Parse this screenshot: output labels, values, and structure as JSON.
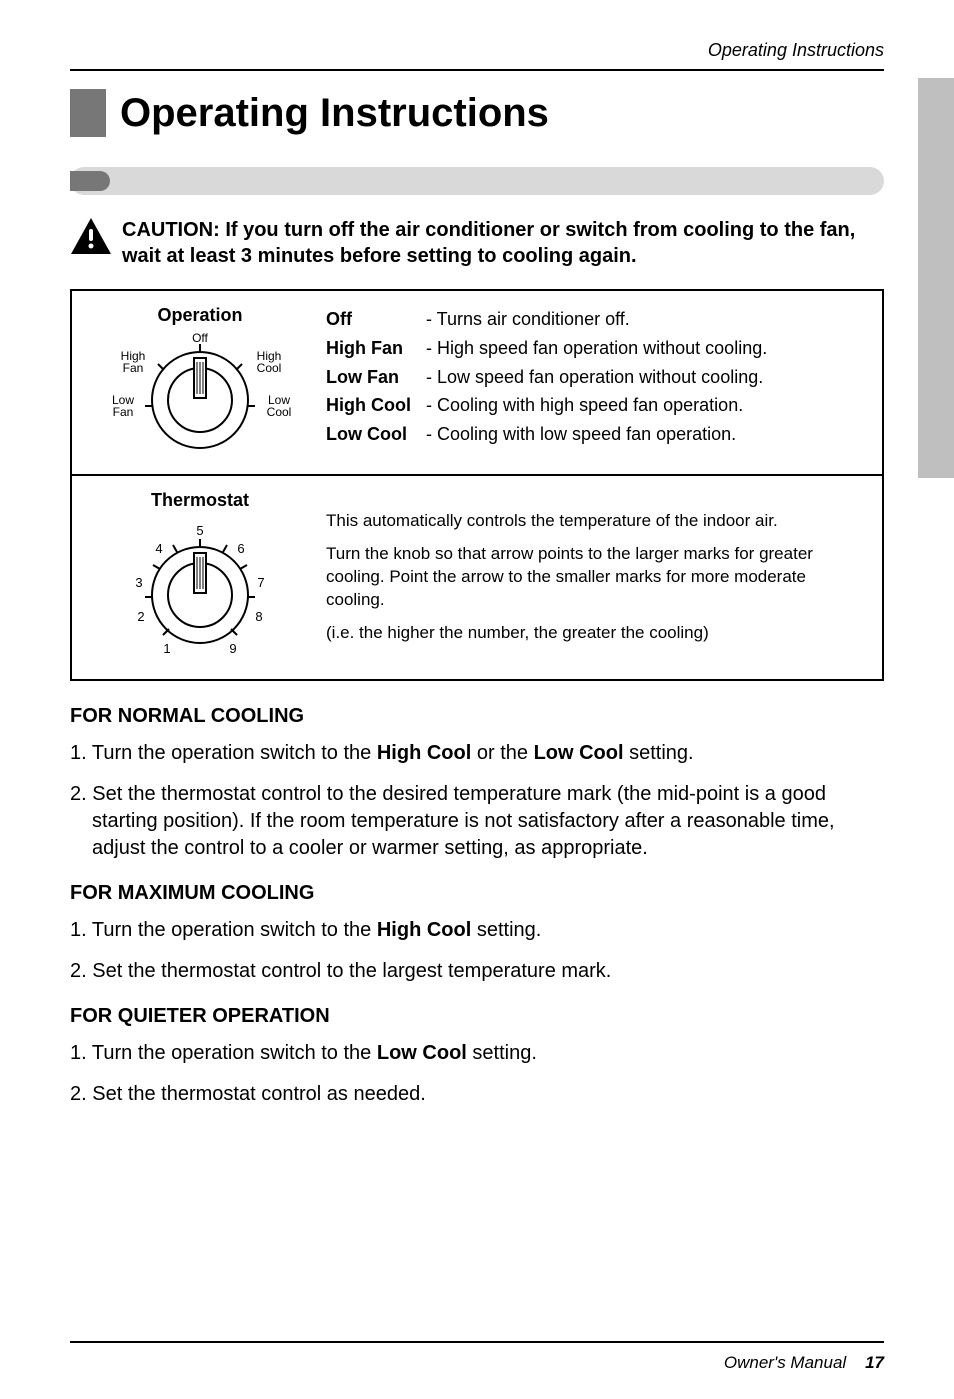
{
  "running_header": "Operating Instructions",
  "title": "Operating Instructions",
  "caution_text": "CAUTION:  If you turn off the air conditioner or switch from cooling to the fan, wait at least 3 minutes before setting to cooling again.",
  "operation": {
    "title": "Operation",
    "labels": {
      "off": "Off",
      "high_fan": "High\nFan",
      "high_cool": "High\nCool",
      "low_fan": "Low\nFan",
      "low_cool": "Low\nCool"
    },
    "modes": [
      {
        "label": "Off",
        "desc": "- Turns air conditioner off."
      },
      {
        "label": "High Fan",
        "desc": "- High speed fan operation without cooling."
      },
      {
        "label": "Low Fan",
        "desc": "- Low speed fan operation without cooling."
      },
      {
        "label": "High Cool",
        "desc": "- Cooling with high speed fan operation."
      },
      {
        "label": "Low Cool",
        "desc": "- Cooling with low speed fan operation."
      }
    ]
  },
  "thermostat": {
    "title": "Thermostat",
    "para1": "This automatically controls the temperature of the indoor air.",
    "para2": "Turn the knob so that arrow points to the larger marks for greater cooling. Point the arrow to the smaller marks for more moderate cooling.",
    "para3": "(i.e. the higher the number, the greater the cooling)",
    "numbers": [
      "1",
      "2",
      "3",
      "4",
      "5",
      "6",
      "7",
      "8",
      "9"
    ]
  },
  "sections": {
    "normal": {
      "head": "FOR NORMAL COOLING",
      "item1_pre": "1. Turn the operation switch to the ",
      "item1_b1": "High Cool",
      "item1_mid": " or the ",
      "item1_b2": "Low Cool",
      "item1_post": " setting.",
      "item2": "2. Set the thermostat control to the desired temperature mark (the mid-point is a good starting position). If the room temperature is not satisfactory after a reasonable time, adjust the control to a cooler or warmer setting, as appropriate."
    },
    "max": {
      "head": "FOR MAXIMUM COOLING",
      "item1_pre": "1. Turn the operation switch to the ",
      "item1_b1": "High Cool",
      "item1_post": " setting.",
      "item2": "2. Set the thermostat control to the largest temperature mark."
    },
    "quiet": {
      "head": "FOR QUIETER OPERATION",
      "item1_pre": "1. Turn the operation switch to the ",
      "item1_b1": "Low Cool",
      "item1_post": " setting.",
      "item2": "2. Set the thermostat control as needed."
    }
  },
  "footer": {
    "label": "Owner's Manual",
    "page": "17"
  }
}
